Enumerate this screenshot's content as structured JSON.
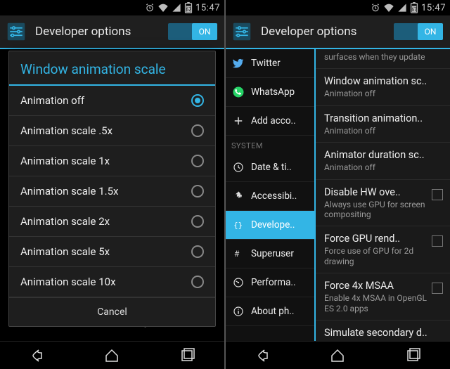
{
  "status": {
    "battery": "67",
    "time": "15:47"
  },
  "actionbar": {
    "title": "Developer options",
    "toggle": "ON"
  },
  "dialog": {
    "title": "Window animation scale",
    "options": [
      "Animation off",
      "Animation scale .5x",
      "Animation scale 1x",
      "Animation scale 1.5x",
      "Animation scale 2x",
      "Animation scale 5x",
      "Animation scale 10x"
    ],
    "selected_index": 0,
    "cancel": "Cancel"
  },
  "under_dialog_hint": "Simulate secondary d..",
  "left_menu": {
    "apps": [
      {
        "label": "Twitter"
      },
      {
        "label": "WhatsApp"
      },
      {
        "label": "Add acco.."
      }
    ],
    "header": "SYSTEM",
    "system": [
      "Date & ti..",
      "Accessibi..",
      "Develope..",
      "Superuser",
      "Performa..",
      "About ph.."
    ],
    "selected_system_index": 2
  },
  "settings": [
    {
      "title": "",
      "sub": "surfaces when they update",
      "checkbox": false,
      "partial_top": true
    },
    {
      "title": "Window animation sc..",
      "sub": "Animation off"
    },
    {
      "title": "Transition animation..",
      "sub": "Animation off"
    },
    {
      "title": "Animator duration sc..",
      "sub": "Animation off"
    },
    {
      "title": "Disable HW ove..",
      "sub": "Always use GPU for screen compositing",
      "checkbox": true
    },
    {
      "title": "Force GPU rend..",
      "sub": "Force use of GPU for 2d drawing",
      "checkbox": true
    },
    {
      "title": "Force 4x MSAA",
      "sub": "Enable 4x MSAA in OpenGL ES 2.0 apps",
      "checkbox": true
    },
    {
      "title": "Simulate secondary d..",
      "sub": ""
    }
  ]
}
